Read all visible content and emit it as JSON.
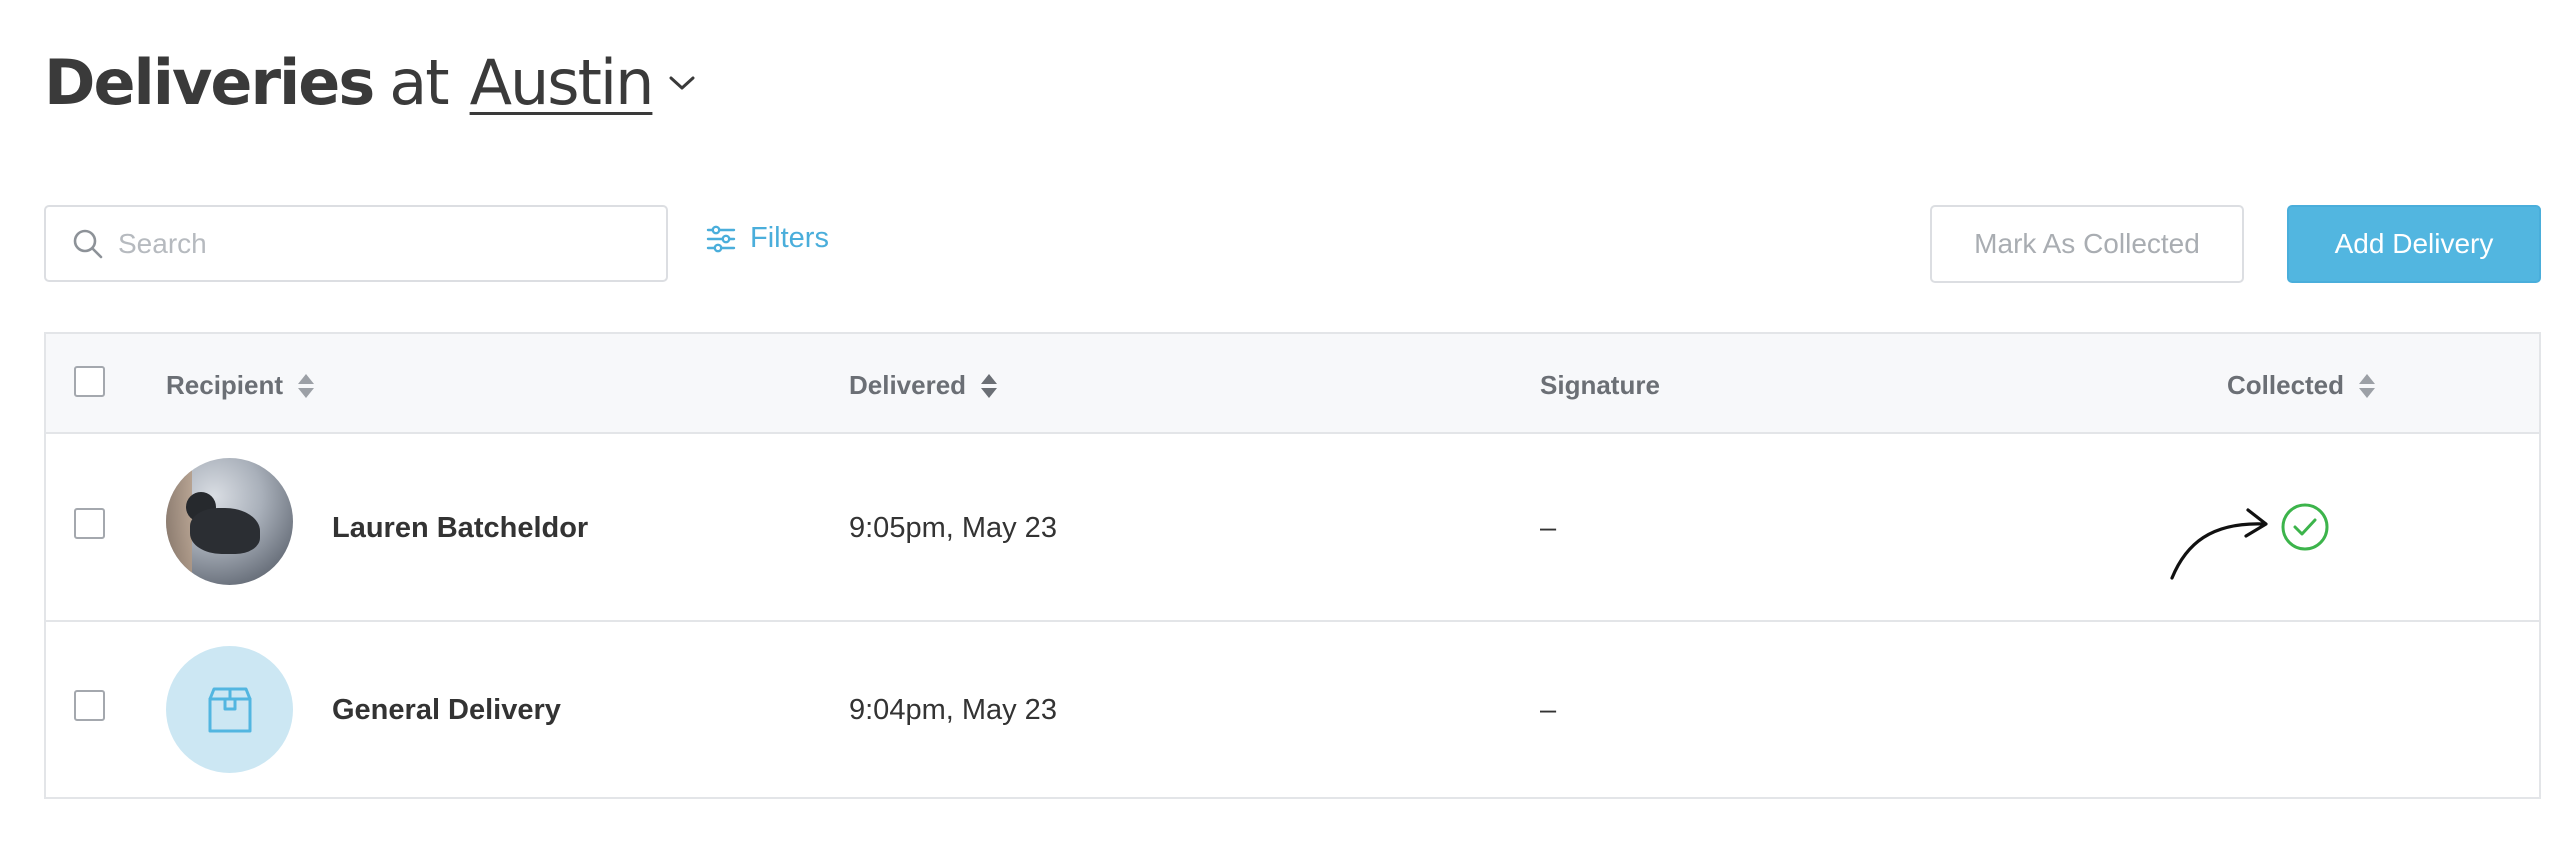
{
  "header": {
    "title_bold": "Deliveries",
    "title_connector": "at",
    "location": "Austin",
    "location_icon": "chevron-down-icon"
  },
  "toolbar": {
    "search_placeholder": "Search",
    "search_value": "",
    "search_icon": "search-icon",
    "filters_label": "Filters",
    "filters_icon": "sliders-icon",
    "mark_collected_label": "Mark As Collected",
    "add_delivery_label": "Add Delivery"
  },
  "colors": {
    "accent": "#52b6e0",
    "link": "#4aaedb",
    "success": "#3cb44b",
    "muted_text": "#a9adb2",
    "avatar_package_bg": "#cce7f3"
  },
  "table": {
    "columns": [
      {
        "label": "Recipient",
        "sortable": true
      },
      {
        "label": "Delivered",
        "sortable": true
      },
      {
        "label": "Signature",
        "sortable": false
      },
      {
        "label": "Collected",
        "sortable": true
      }
    ],
    "rows": [
      {
        "recipient": "Lauren Batcheldor",
        "avatar": "photo",
        "delivered": "9:05pm, May 23",
        "signature": "–",
        "collected": true
      },
      {
        "recipient": "General Delivery",
        "avatar": "package-icon",
        "delivered": "9:04pm, May 23",
        "signature": "–",
        "collected": false
      }
    ]
  }
}
